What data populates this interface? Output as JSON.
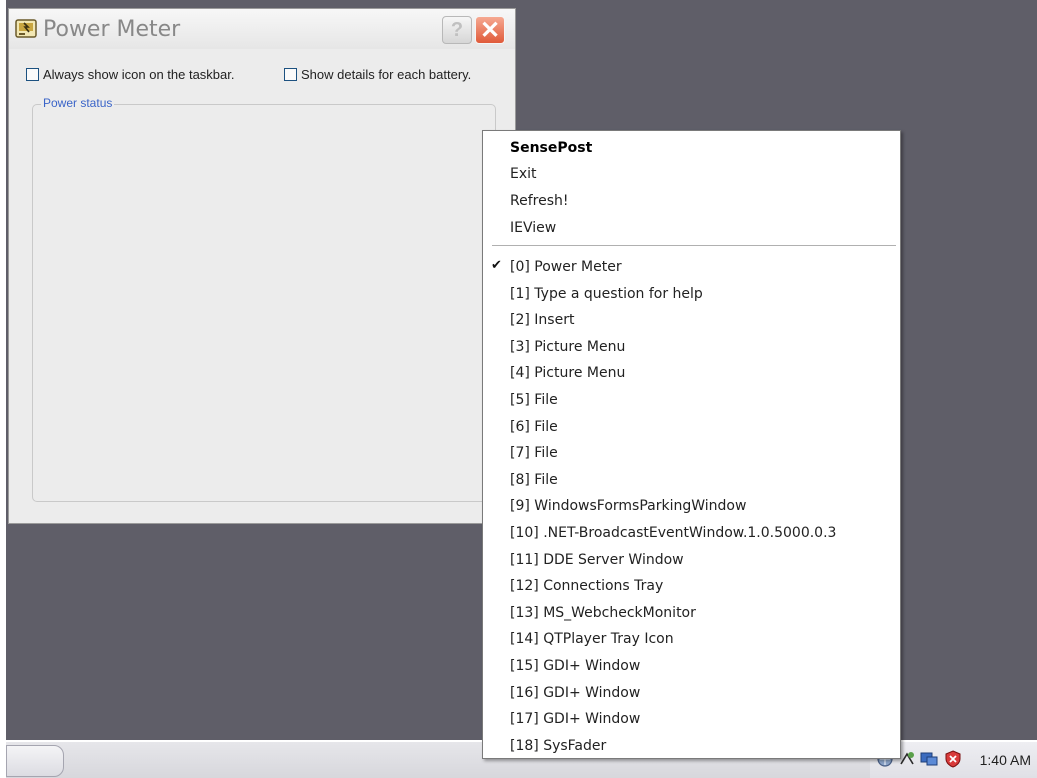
{
  "window": {
    "title": "Power Meter",
    "help_glyph": "?",
    "close_glyph": "✕",
    "checkbox_taskbar": "Always show icon on the taskbar.",
    "checkbox_details": "Show details for each battery.",
    "group_label": "Power status"
  },
  "menu": {
    "header": "SensePost",
    "actions": [
      "Exit",
      "Refresh!",
      "IEView"
    ],
    "check_glyph": "✔",
    "windows": [
      "[0] Power Meter",
      "[1] Type a question for help",
      "[2] Insert",
      "[3] Picture Menu",
      "[4] Picture Menu",
      "[5] File",
      "[6] File",
      "[7] File",
      "[8] File",
      "[9] WindowsFormsParkingWindow",
      "[10] .NET-BroadcastEventWindow.1.0.5000.0.3",
      "[11] DDE Server Window",
      "[12] Connections Tray",
      "[13] MS_WebcheckMonitor",
      "[14] QTPlayer Tray Icon",
      "[15] GDI+ Window",
      "[16] GDI+ Window",
      "[17] GDI+ Window",
      "[18] SysFader"
    ]
  },
  "taskbar": {
    "clock": "1:40 AM",
    "tray_icons": [
      "network-icon",
      "connections-icon",
      "monitor-icon",
      "security-shield-icon"
    ]
  },
  "colors": {
    "desktop": "#5f5e68",
    "close_button": "#e05a3a",
    "group_label": "#3a64c8"
  }
}
